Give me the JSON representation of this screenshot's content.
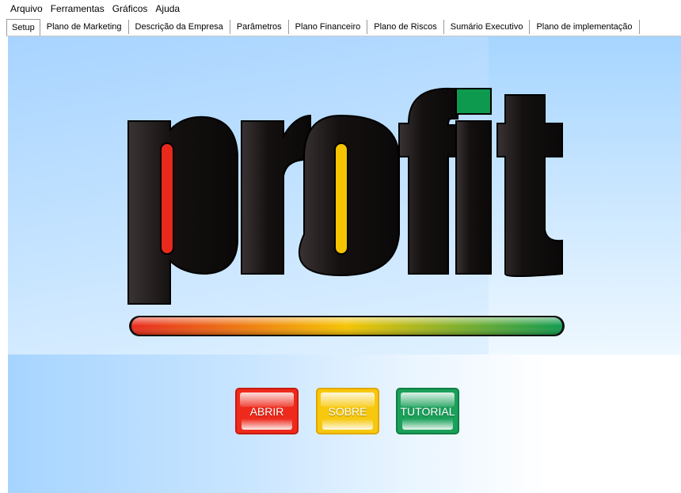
{
  "menubar": {
    "items": [
      "Arquivo",
      "Ferramentas",
      "Gráficos",
      "Ajuda"
    ]
  },
  "tabs": [
    {
      "label": "Setup",
      "active": true
    },
    {
      "label": "Plano de Marketing",
      "active": false
    },
    {
      "label": "Descrição da Empresa",
      "active": false
    },
    {
      "label": "Parâmetros",
      "active": false
    },
    {
      "label": "Plano Financeiro",
      "active": false
    },
    {
      "label": "Plano de Riscos",
      "active": false
    },
    {
      "label": "Sumário Executivo",
      "active": false
    },
    {
      "label": "Plano de implementação",
      "active": false
    }
  ],
  "logo": {
    "text": "profit",
    "colors": {
      "letters": "#141010",
      "accent_red": "#e8291c",
      "accent_yellow": "#f5c400",
      "accent_green": "#0e9a4e"
    },
    "bar_gradient": [
      "#e8291c",
      "#f5c400",
      "#0e9a4e"
    ]
  },
  "buttons": {
    "abrir": {
      "label": "ABRIR",
      "color": "#ee2a1c"
    },
    "sobre": {
      "label": "SOBRE",
      "color": "#f7c80d"
    },
    "tutorial": {
      "label": "TUTORIAL",
      "color": "#1ba05a"
    }
  }
}
